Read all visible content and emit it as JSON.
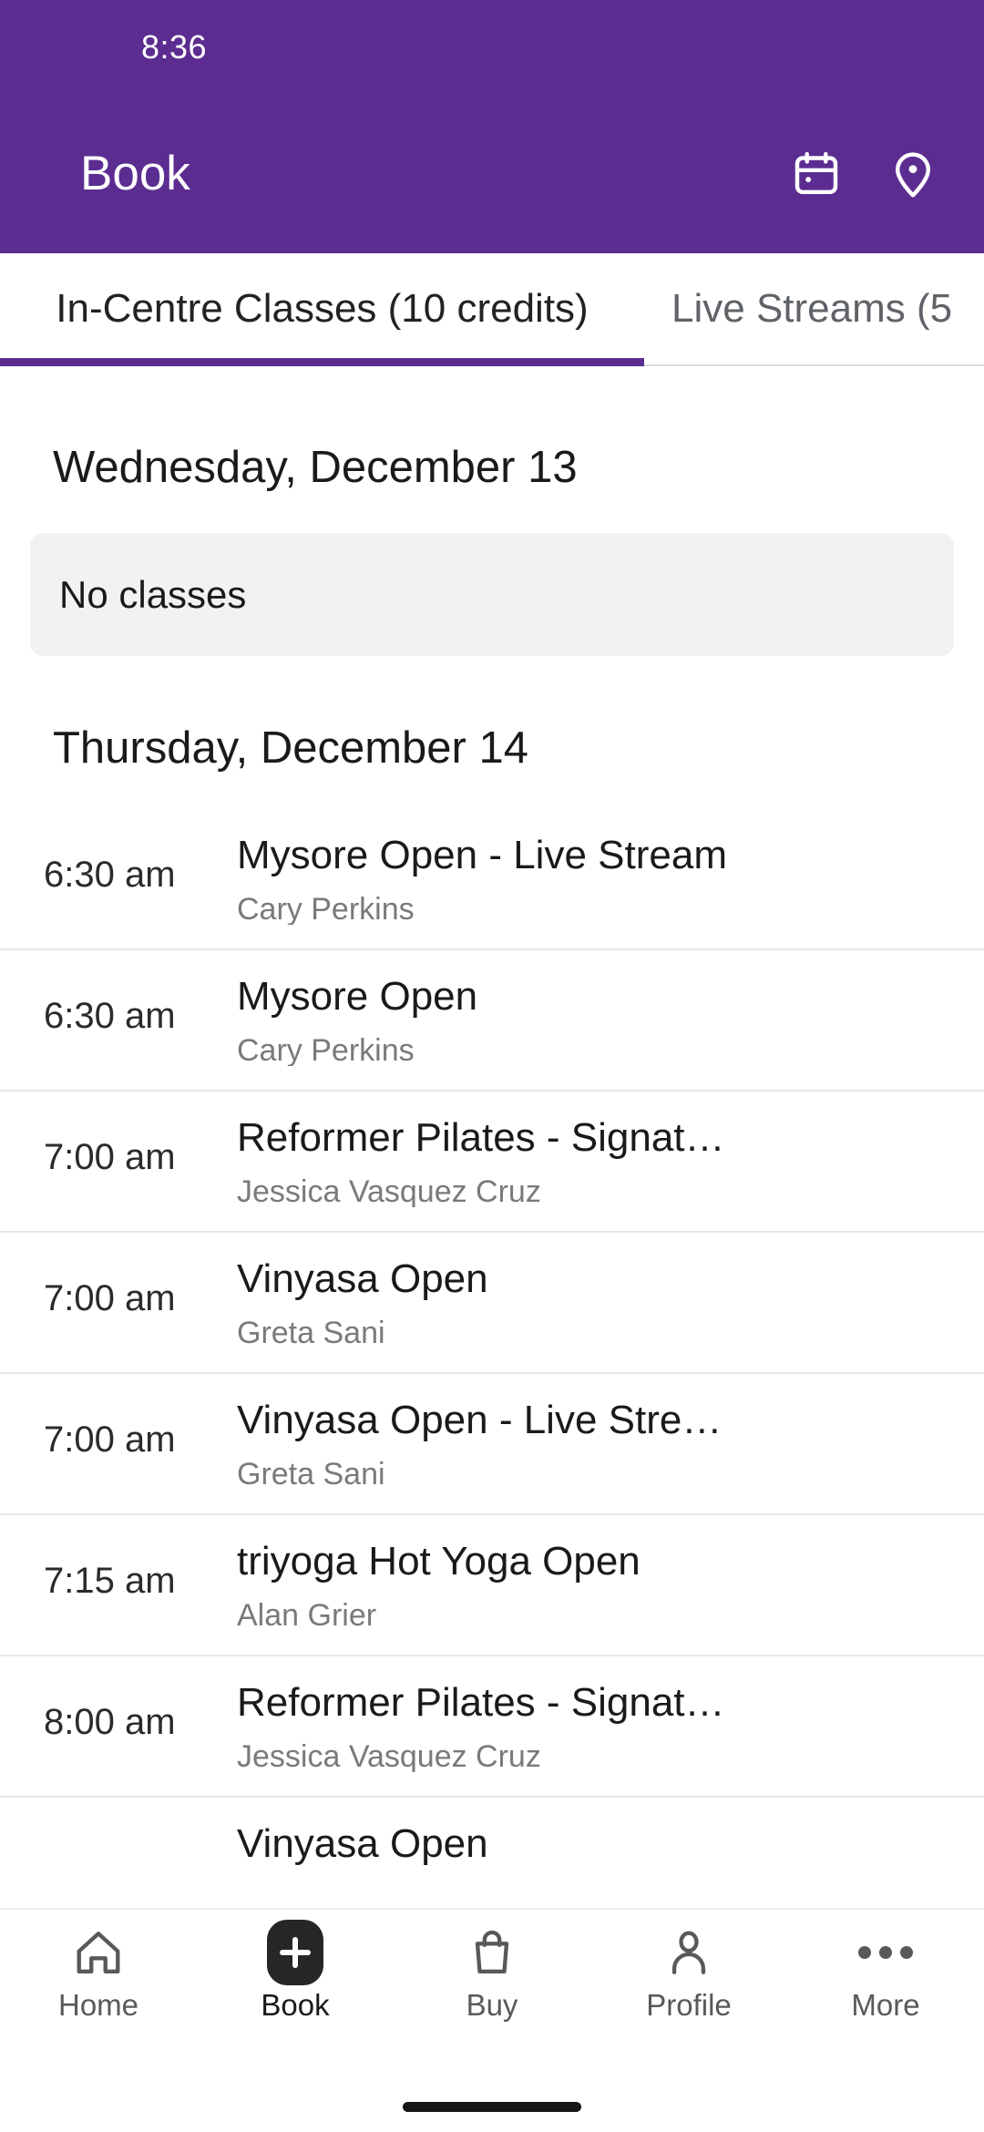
{
  "theme": {
    "brand_purple": "#5C2D91",
    "card_gray": "#F2F2F2",
    "divider": "#E8E8E8",
    "muted_text": "#7A7A7A"
  },
  "status_bar": {
    "clock": "8:36"
  },
  "app_bar": {
    "title": "Book",
    "actions": [
      {
        "name": "calendar-icon",
        "label": "Calendar"
      },
      {
        "name": "location-pin-icon",
        "label": "Location"
      }
    ]
  },
  "tabs": {
    "active_index": 0,
    "items": [
      {
        "label": "In-Centre Classes (10 credits)",
        "active": true
      },
      {
        "label": "Live Streams (5",
        "active": false
      }
    ]
  },
  "schedule": {
    "days": [
      {
        "heading": "Wednesday, December 13",
        "empty_label": "No classes",
        "classes": []
      },
      {
        "heading": "Thursday, December 14",
        "empty_label": "",
        "classes": [
          {
            "time": "6:30 am",
            "title": "Mysore Open - Live Stream",
            "teacher": "Cary Perkins"
          },
          {
            "time": "6:30 am",
            "title": "Mysore Open",
            "teacher": "Cary Perkins"
          },
          {
            "time": "7:00 am",
            "title": "Reformer Pilates - Signat…",
            "teacher": "Jessica Vasquez Cruz"
          },
          {
            "time": "7:00 am",
            "title": "Vinyasa Open",
            "teacher": "Greta Sani"
          },
          {
            "time": "7:00 am",
            "title": "Vinyasa Open - Live Stre…",
            "teacher": "Greta Sani"
          },
          {
            "time": "7:15 am",
            "title": "triyoga Hot Yoga Open",
            "teacher": "Alan Grier"
          },
          {
            "time": "8:00 am",
            "title": "Reformer Pilates - Signat…",
            "teacher": "Jessica Vasquez Cruz"
          },
          {
            "time": "",
            "title": "Vinyasa Open",
            "teacher": ""
          }
        ]
      }
    ]
  },
  "bottom_nav": {
    "active": "Book",
    "items": [
      {
        "label": "Home",
        "icon": "home-icon"
      },
      {
        "label": "Book",
        "icon": "plus-book-icon"
      },
      {
        "label": "Buy",
        "icon": "shopping-bag-icon"
      },
      {
        "label": "Profile",
        "icon": "person-icon"
      },
      {
        "label": "More",
        "icon": "more-dots-icon"
      }
    ]
  }
}
